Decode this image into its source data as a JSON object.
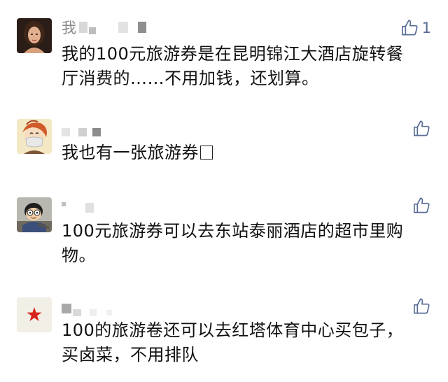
{
  "comments": [
    {
      "avatar_icon": "woman-portrait-avatar-icon",
      "name_prefix": "我",
      "likes": "1",
      "lines": [
        "我的100元旅游券是在昆明锦江大酒店旋转餐",
        "厅消费的……不用加钱，还划算。"
      ]
    },
    {
      "avatar_icon": "masked-girl-avatar-icon",
      "name_prefix": "",
      "likes": "",
      "lines": [
        "我也有一张旅游券"
      ]
    },
    {
      "avatar_icon": "cartoon-boy-avatar-icon",
      "name_prefix": "",
      "likes": "",
      "lines": [
        "100元旅游券可以去东站泰丽酒店的超市里购",
        "物。"
      ]
    },
    {
      "avatar_icon": "red-star-avatar-icon",
      "name_prefix": "",
      "likes": "",
      "lines": [
        "100的旅游卷还可以去红塔体育中心买包子，",
        "买卤菜，不用排队"
      ]
    }
  ],
  "colors": {
    "like_blue": "#576b95",
    "text": "#111111",
    "name_gray": "#8a8a8a"
  }
}
